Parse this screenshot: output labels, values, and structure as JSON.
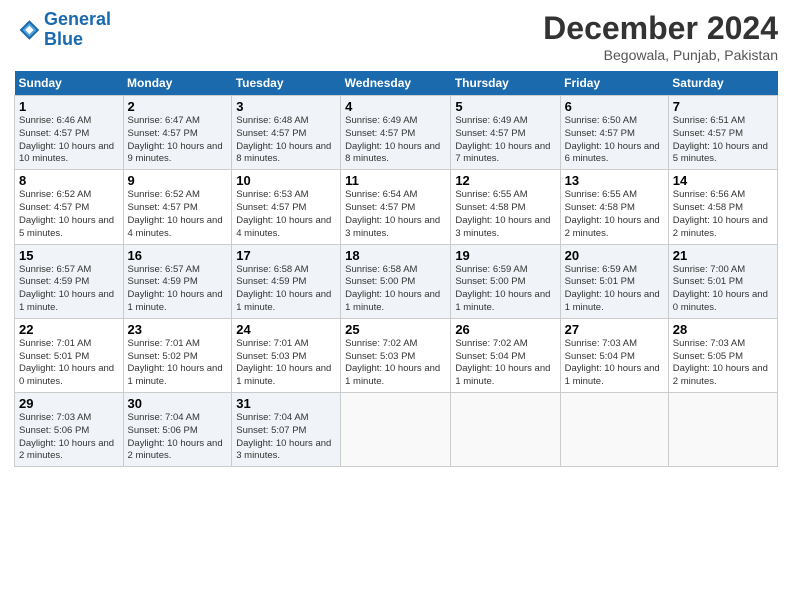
{
  "header": {
    "logo_line1": "General",
    "logo_line2": "Blue",
    "month": "December 2024",
    "location": "Begowala, Punjab, Pakistan"
  },
  "weekdays": [
    "Sunday",
    "Monday",
    "Tuesday",
    "Wednesday",
    "Thursday",
    "Friday",
    "Saturday"
  ],
  "weeks": [
    [
      {
        "day": "1",
        "info": "Sunrise: 6:46 AM\nSunset: 4:57 PM\nDaylight: 10 hours and 10 minutes."
      },
      {
        "day": "2",
        "info": "Sunrise: 6:47 AM\nSunset: 4:57 PM\nDaylight: 10 hours and 9 minutes."
      },
      {
        "day": "3",
        "info": "Sunrise: 6:48 AM\nSunset: 4:57 PM\nDaylight: 10 hours and 8 minutes."
      },
      {
        "day": "4",
        "info": "Sunrise: 6:49 AM\nSunset: 4:57 PM\nDaylight: 10 hours and 8 minutes."
      },
      {
        "day": "5",
        "info": "Sunrise: 6:49 AM\nSunset: 4:57 PM\nDaylight: 10 hours and 7 minutes."
      },
      {
        "day": "6",
        "info": "Sunrise: 6:50 AM\nSunset: 4:57 PM\nDaylight: 10 hours and 6 minutes."
      },
      {
        "day": "7",
        "info": "Sunrise: 6:51 AM\nSunset: 4:57 PM\nDaylight: 10 hours and 5 minutes."
      }
    ],
    [
      {
        "day": "8",
        "info": "Sunrise: 6:52 AM\nSunset: 4:57 PM\nDaylight: 10 hours and 5 minutes."
      },
      {
        "day": "9",
        "info": "Sunrise: 6:52 AM\nSunset: 4:57 PM\nDaylight: 10 hours and 4 minutes."
      },
      {
        "day": "10",
        "info": "Sunrise: 6:53 AM\nSunset: 4:57 PM\nDaylight: 10 hours and 4 minutes."
      },
      {
        "day": "11",
        "info": "Sunrise: 6:54 AM\nSunset: 4:57 PM\nDaylight: 10 hours and 3 minutes."
      },
      {
        "day": "12",
        "info": "Sunrise: 6:55 AM\nSunset: 4:58 PM\nDaylight: 10 hours and 3 minutes."
      },
      {
        "day": "13",
        "info": "Sunrise: 6:55 AM\nSunset: 4:58 PM\nDaylight: 10 hours and 2 minutes."
      },
      {
        "day": "14",
        "info": "Sunrise: 6:56 AM\nSunset: 4:58 PM\nDaylight: 10 hours and 2 minutes."
      }
    ],
    [
      {
        "day": "15",
        "info": "Sunrise: 6:57 AM\nSunset: 4:59 PM\nDaylight: 10 hours and 1 minute."
      },
      {
        "day": "16",
        "info": "Sunrise: 6:57 AM\nSunset: 4:59 PM\nDaylight: 10 hours and 1 minute."
      },
      {
        "day": "17",
        "info": "Sunrise: 6:58 AM\nSunset: 4:59 PM\nDaylight: 10 hours and 1 minute."
      },
      {
        "day": "18",
        "info": "Sunrise: 6:58 AM\nSunset: 5:00 PM\nDaylight: 10 hours and 1 minute."
      },
      {
        "day": "19",
        "info": "Sunrise: 6:59 AM\nSunset: 5:00 PM\nDaylight: 10 hours and 1 minute."
      },
      {
        "day": "20",
        "info": "Sunrise: 6:59 AM\nSunset: 5:01 PM\nDaylight: 10 hours and 1 minute."
      },
      {
        "day": "21",
        "info": "Sunrise: 7:00 AM\nSunset: 5:01 PM\nDaylight: 10 hours and 0 minutes."
      }
    ],
    [
      {
        "day": "22",
        "info": "Sunrise: 7:01 AM\nSunset: 5:01 PM\nDaylight: 10 hours and 0 minutes."
      },
      {
        "day": "23",
        "info": "Sunrise: 7:01 AM\nSunset: 5:02 PM\nDaylight: 10 hours and 1 minute."
      },
      {
        "day": "24",
        "info": "Sunrise: 7:01 AM\nSunset: 5:03 PM\nDaylight: 10 hours and 1 minute."
      },
      {
        "day": "25",
        "info": "Sunrise: 7:02 AM\nSunset: 5:03 PM\nDaylight: 10 hours and 1 minute."
      },
      {
        "day": "26",
        "info": "Sunrise: 7:02 AM\nSunset: 5:04 PM\nDaylight: 10 hours and 1 minute."
      },
      {
        "day": "27",
        "info": "Sunrise: 7:03 AM\nSunset: 5:04 PM\nDaylight: 10 hours and 1 minute."
      },
      {
        "day": "28",
        "info": "Sunrise: 7:03 AM\nSunset: 5:05 PM\nDaylight: 10 hours and 2 minutes."
      }
    ],
    [
      {
        "day": "29",
        "info": "Sunrise: 7:03 AM\nSunset: 5:06 PM\nDaylight: 10 hours and 2 minutes."
      },
      {
        "day": "30",
        "info": "Sunrise: 7:04 AM\nSunset: 5:06 PM\nDaylight: 10 hours and 2 minutes."
      },
      {
        "day": "31",
        "info": "Sunrise: 7:04 AM\nSunset: 5:07 PM\nDaylight: 10 hours and 3 minutes."
      },
      null,
      null,
      null,
      null
    ]
  ]
}
